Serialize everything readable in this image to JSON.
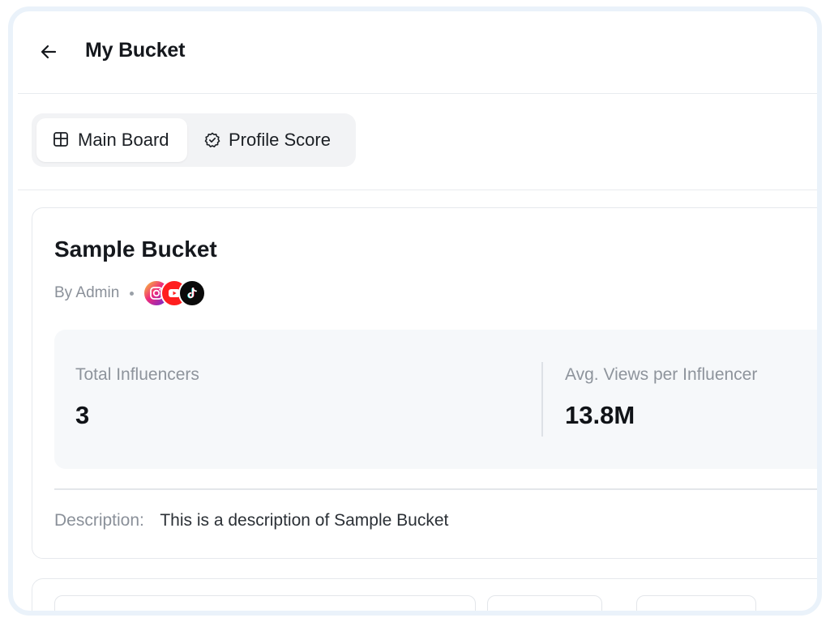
{
  "header": {
    "title": "My Bucket",
    "back_icon": "arrow-left-icon"
  },
  "tabs": [
    {
      "label": "Main Board",
      "icon": "board-grid-icon",
      "active": true
    },
    {
      "label": "Profile Score",
      "icon": "gear-check-icon",
      "active": false
    }
  ],
  "bucket": {
    "title": "Sample Bucket",
    "byline": "By Admin",
    "platforms": [
      "instagram-icon",
      "youtube-icon",
      "tiktok-icon"
    ],
    "stats": [
      {
        "label": "Total Influencers",
        "value": "3"
      },
      {
        "label": "Avg. Views per Influencer",
        "value": "13.8M"
      }
    ],
    "description_label": "Description:",
    "description": "This is a description of Sample Bucket"
  },
  "colors": {
    "frame": "#eaf2fa",
    "stats_bg": "#f6f8fa",
    "instagram": "#ee2a7b",
    "youtube": "#ff1e1e",
    "tiktok": "#0a0a0a"
  }
}
